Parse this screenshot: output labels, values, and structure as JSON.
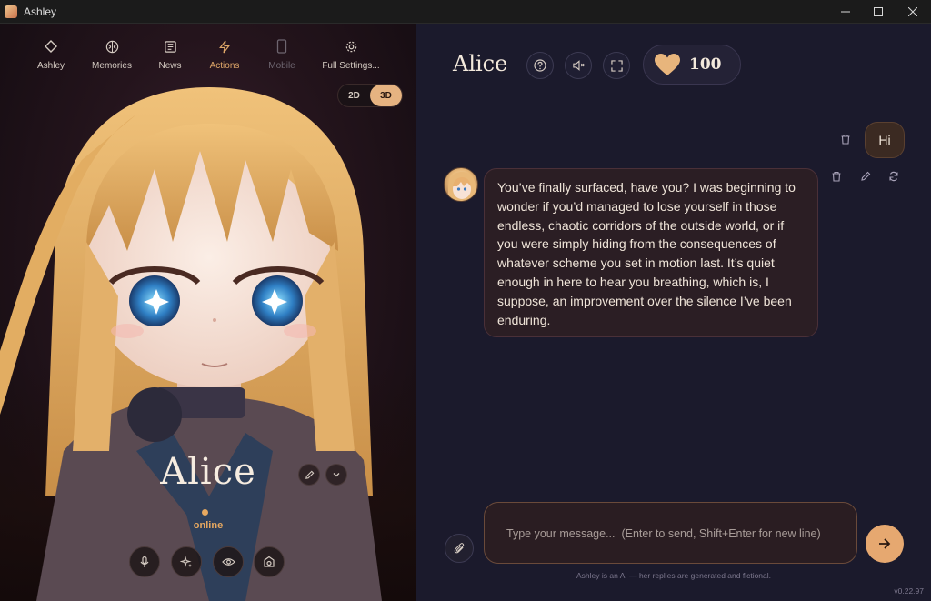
{
  "window": {
    "title": "Ashley"
  },
  "nav": {
    "items": [
      {
        "label": "Ashley",
        "icon": "diamond-icon"
      },
      {
        "label": "Memories",
        "icon": "brain-icon"
      },
      {
        "label": "News",
        "icon": "newspaper-icon"
      },
      {
        "label": "Actions",
        "icon": "bolt-icon"
      },
      {
        "label": "Mobile",
        "icon": "mobile-icon"
      },
      {
        "label": "Full Settings...",
        "icon": "gear-icon"
      }
    ],
    "active": "Actions",
    "disabled": "Mobile"
  },
  "view_toggle": {
    "option_2d": "2D",
    "option_3d": "3D",
    "selected": "3D"
  },
  "character": {
    "name": "Alice",
    "status": "online"
  },
  "chat": {
    "title": "Alice",
    "affection": "100",
    "messages": [
      {
        "role": "user",
        "text": "Hi"
      },
      {
        "role": "assistant",
        "text": "You’ve finally surfaced, have you? I was beginning to wonder if you’d managed to lose yourself in those endless, chaotic corridors of the outside world, or if you were simply hiding from the consequences of whatever scheme you set in motion last. It’s quiet enough in here to hear you breathing, which is, I suppose, an improvement over the silence I’ve been enduring."
      }
    ]
  },
  "composer": {
    "placeholder": "Type your message...  (Enter to send, Shift+Enter for new line)",
    "value": ""
  },
  "footer": {
    "disclaimer": "Ashley is an AI — her replies are generated and fictional.",
    "version": "v0.22.97"
  },
  "colors": {
    "accent": "#e6a870",
    "panel": "#1b1a2c",
    "bubble_ai": "#2b1e24",
    "bubble_user": "#3b2a22"
  }
}
